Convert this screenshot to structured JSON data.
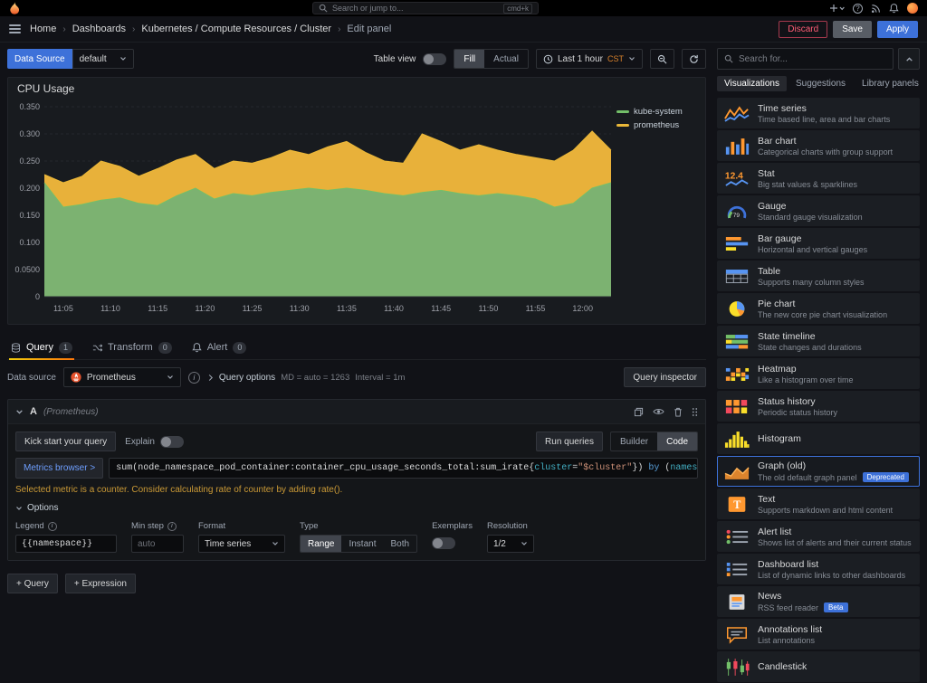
{
  "topnav": {
    "search_placeholder": "Search or jump to...",
    "shortcut": "cmd+k"
  },
  "breadcrumb": {
    "items": [
      "Home",
      "Dashboards",
      "Kubernetes / Compute Resources / Cluster",
      "Edit panel"
    ]
  },
  "actions": {
    "discard": "Discard",
    "save": "Save",
    "apply": "Apply"
  },
  "toolbar": {
    "datasource_label": "Data Source",
    "datasource_value": "default",
    "table_view_label": "Table view",
    "fill_label": "Fill",
    "actual_label": "Actual",
    "time_range": "Last 1 hour",
    "timezone": "CST"
  },
  "panel": {
    "title": "CPU Usage"
  },
  "chart_data": {
    "type": "area",
    "stacked": true,
    "title": "CPU Usage",
    "x_minutes": [
      3,
      5,
      7,
      9,
      11,
      13,
      15,
      17,
      19,
      21,
      23,
      25,
      27,
      29,
      31,
      33,
      35,
      37,
      39,
      41,
      43,
      45,
      47,
      49,
      51,
      53,
      55,
      57,
      59,
      61,
      63
    ],
    "x_tick_minutes": [
      5,
      10,
      15,
      20,
      25,
      30,
      35,
      40,
      45,
      50,
      55,
      60
    ],
    "x_tick_labels": [
      "11:05",
      "11:10",
      "11:15",
      "11:20",
      "11:25",
      "11:30",
      "11:35",
      "11:40",
      "11:45",
      "11:50",
      "11:55",
      "12:00"
    ],
    "y_ticks": [
      0,
      0.05,
      0.1,
      0.15,
      0.2,
      0.25,
      0.3,
      0.35
    ],
    "y_tick_labels": [
      "0",
      "0.0500",
      "0.100",
      "0.150",
      "0.200",
      "0.250",
      "0.300",
      "0.350"
    ],
    "ylim": [
      0,
      0.35
    ],
    "legend_position": "right",
    "series": [
      {
        "name": "kube-system",
        "color": "#73bf69",
        "fill": "#7cb271",
        "values": [
          0.21,
          0.165,
          0.17,
          0.178,
          0.182,
          0.172,
          0.168,
          0.186,
          0.2,
          0.18,
          0.19,
          0.186,
          0.192,
          0.196,
          0.2,
          0.196,
          0.2,
          0.196,
          0.19,
          0.186,
          0.192,
          0.196,
          0.19,
          0.186,
          0.19,
          0.186,
          0.18,
          0.165,
          0.172,
          0.2,
          0.21
        ]
      },
      {
        "name": "prometheus",
        "color": "#eab839",
        "fill": "#e8b13a",
        "values": [
          0.015,
          0.045,
          0.052,
          0.072,
          0.058,
          0.05,
          0.068,
          0.066,
          0.062,
          0.056,
          0.06,
          0.06,
          0.064,
          0.074,
          0.062,
          0.08,
          0.086,
          0.07,
          0.06,
          0.06,
          0.108,
          0.09,
          0.08,
          0.094,
          0.08,
          0.076,
          0.076,
          0.085,
          0.098,
          0.105,
          0.06
        ]
      }
    ]
  },
  "tabs": [
    {
      "label": "Query",
      "count": "1"
    },
    {
      "label": "Transform",
      "count": "0"
    },
    {
      "label": "Alert",
      "count": "0"
    }
  ],
  "query_row": {
    "label": "Data source",
    "datasource": "Prometheus",
    "options_label": "Query options",
    "meta1": "MD = auto = 1263",
    "meta2": "Interval = 1m",
    "inspector_label": "Query inspector"
  },
  "query": {
    "ref": "A",
    "datasource_hint": "(Prometheus)",
    "kickstart_label": "Kick start your query",
    "explain_label": "Explain",
    "run_label": "Run queries",
    "builder_label": "Builder",
    "code_label": "Code",
    "metrics_browser_label": "Metrics browser >",
    "expression_full": "sum(node_namespace_pod_container:container_cpu_usage_seconds_total:sum_irate{cluster=\"$cluster\"}) by (namespace)",
    "expression_segments": [
      {
        "text": "sum(node_namespace_pod_container:container_cpu_usage_seconds_total:sum_irate{",
        "style": "plain"
      },
      {
        "text": "cluster",
        "style": "label"
      },
      {
        "text": "=",
        "style": "op"
      },
      {
        "text": "\"$cluster\"",
        "style": "string"
      },
      {
        "text": "}) ",
        "style": "plain"
      },
      {
        "text": "by ",
        "style": "keyword"
      },
      {
        "text": "(",
        "style": "plain"
      },
      {
        "text": "namespace",
        "style": "label"
      },
      {
        "text": ")",
        "style": "plain"
      }
    ],
    "warning": "Selected metric is a counter. Consider calculating rate of counter by adding rate().",
    "options_label": "Options",
    "fields": {
      "legend_label": "Legend",
      "legend_value": "{{namespace}}",
      "min_step_label": "Min step",
      "min_step_placeholder": "auto",
      "format_label": "Format",
      "format_value": "Time series",
      "type_label": "Type",
      "type_options": [
        "Range",
        "Instant",
        "Both"
      ],
      "type_selected": "Range",
      "exemplars_label": "Exemplars",
      "resolution_label": "Resolution",
      "resolution_value": "1/2"
    }
  },
  "footer": {
    "add_query": "+ Query",
    "add_expression": "+ Expression"
  },
  "sidebar": {
    "search_placeholder": "Search for...",
    "tabs": [
      "Visualizations",
      "Suggestions",
      "Library panels"
    ],
    "active_tab": "Visualizations",
    "items": [
      {
        "title": "Time series",
        "subtitle": "Time based line, area and bar charts",
        "icon": "time-series"
      },
      {
        "title": "Bar chart",
        "subtitle": "Categorical charts with group support",
        "icon": "bar-chart"
      },
      {
        "title": "Stat",
        "subtitle": "Big stat values & sparklines",
        "icon": "stat"
      },
      {
        "title": "Gauge",
        "subtitle": "Standard gauge visualization",
        "icon": "gauge"
      },
      {
        "title": "Bar gauge",
        "subtitle": "Horizontal and vertical gauges",
        "icon": "bar-gauge"
      },
      {
        "title": "Table",
        "subtitle": "Supports many column styles",
        "icon": "table"
      },
      {
        "title": "Pie chart",
        "subtitle": "The new core pie chart visualization",
        "icon": "pie-chart"
      },
      {
        "title": "State timeline",
        "subtitle": "State changes and durations",
        "icon": "state-timeline"
      },
      {
        "title": "Heatmap",
        "subtitle": "Like a histogram over time",
        "icon": "heatmap"
      },
      {
        "title": "Status history",
        "subtitle": "Periodic status history",
        "icon": "status-history"
      },
      {
        "title": "Histogram",
        "subtitle": "",
        "icon": "histogram"
      },
      {
        "title": "Graph (old)",
        "subtitle": "The old default graph panel",
        "icon": "graph-old",
        "badge": "Deprecated",
        "selected": true
      },
      {
        "title": "Text",
        "subtitle": "Supports markdown and html content",
        "icon": "text"
      },
      {
        "title": "Alert list",
        "subtitle": "Shows list of alerts and their current status",
        "icon": "alert-list"
      },
      {
        "title": "Dashboard list",
        "subtitle": "List of dynamic links to other dashboards",
        "icon": "dashboard-list"
      },
      {
        "title": "News",
        "subtitle": "RSS feed reader",
        "icon": "news",
        "badge": "Beta"
      },
      {
        "title": "Annotations list",
        "subtitle": "List annotations",
        "icon": "annotations-list"
      },
      {
        "title": "Candlestick",
        "subtitle": "",
        "icon": "candlestick"
      }
    ]
  }
}
